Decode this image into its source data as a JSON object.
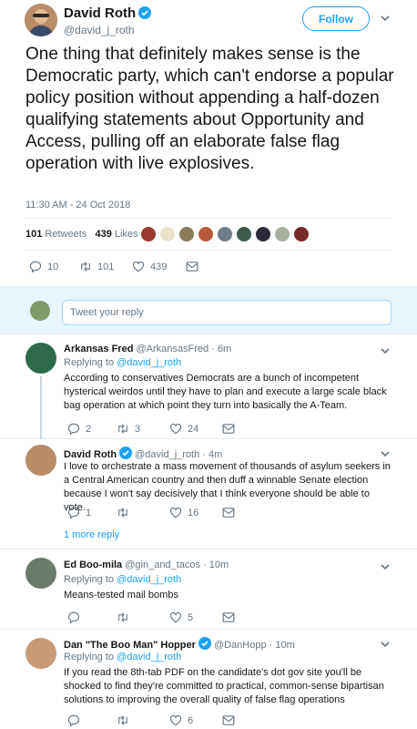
{
  "main_tweet": {
    "author_name": "David Roth",
    "author_handle": "@david_j_roth",
    "follow_label": "Follow",
    "text": "One thing that definitely makes sense is the Democratic party, which can't endorse a popular policy position without appending a half-dozen qualifying statements about Opportunity and Access, pulling off an elaborate false flag operation with live explosives.",
    "timestamp": "11:30 AM - 24 Oct 2018",
    "retweets_count": "101",
    "retweets_label": "Retweets",
    "likes_count": "439",
    "likes_label": "Likes",
    "actions": {
      "replies": "10",
      "retweets": "101",
      "likes": "439"
    }
  },
  "composer": {
    "placeholder": "Tweet your reply"
  },
  "replies": [
    {
      "name": "Arkansas Fred",
      "handle": "@ArkansasFred",
      "time": "6m",
      "replying_label": "Replying to",
      "replying_to": "@david_j_roth",
      "text": "According to conservatives Democrats are a bunch of incompetent hysterical weirdos until they have to plan and execute a large scale black bag operation at which point they turn into basically the A-Team.",
      "counts": {
        "replies": "2",
        "retweets": "3",
        "likes": "24"
      }
    },
    {
      "name": "David Roth",
      "handle": "@david_j_roth",
      "time": "4m",
      "text": "I love to orchestrate a mass movement of thousands of asylum seekers in a Central American country and then duff a winnable Senate election because I won't say decisively that I think everyone should be able to vote.",
      "counts": {
        "replies": "1",
        "retweets": "",
        "likes": "16"
      },
      "more_label": "1 more reply"
    },
    {
      "name": "Ed Boo-mila",
      "handle": "@gin_and_tacos",
      "time": "10m",
      "replying_label": "Replying to",
      "replying_to": "@david_j_roth",
      "text": "Means-tested mail bombs",
      "counts": {
        "replies": "",
        "retweets": "",
        "likes": "5"
      }
    },
    {
      "name": "Dan \"The Boo Man\" Hopper",
      "handle": "@DanHopp",
      "time": "10m",
      "replying_label": "Replying to",
      "replying_to": "@david_j_roth",
      "text": "If you read the 8th-tab PDF on the candidate's dot gov site you'll be shocked to find they're committed to practical, common-sense bipartisan solutions to improving the overall quality of false flag operations",
      "counts": {
        "replies": "",
        "retweets": "",
        "likes": "6"
      }
    }
  ],
  "colors": {
    "accent": "#1da1f2",
    "muted": "#657786",
    "text": "#14171a",
    "composer_bg": "#e8f5fd"
  },
  "icons": [
    "verified-badge-icon",
    "chevron-down-icon",
    "reply-icon",
    "retweet-icon",
    "heart-icon",
    "envelope-icon"
  ]
}
